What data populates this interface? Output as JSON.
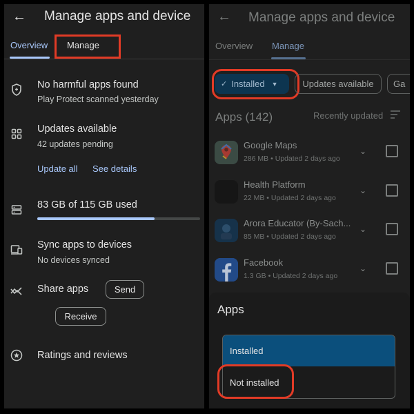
{
  "left": {
    "title": "Manage apps and device",
    "tabs": [
      {
        "label": "Overview",
        "active": true
      },
      {
        "label": "Manage",
        "active": false
      }
    ],
    "protect": {
      "title": "No harmful apps found",
      "subtitle": "Play Protect scanned yesterday",
      "icon": "shield-icon"
    },
    "updates": {
      "title": "Updates available",
      "subtitle": "42 updates pending",
      "icon": "apps-grid-icon",
      "update_all": "Update all",
      "see_details": "See details"
    },
    "storage": {
      "title": "83 GB of 115 GB used",
      "used_gb": 83,
      "total_gb": 115,
      "icon": "storage-icon"
    },
    "sync": {
      "title": "Sync apps to devices",
      "subtitle": "No devices synced",
      "icon": "devices-icon"
    },
    "share": {
      "title": "Share apps",
      "send": "Send",
      "receive": "Receive",
      "icon": "share-arrows-icon"
    },
    "ratings": {
      "title": "Ratings and reviews",
      "icon": "star-circle-icon"
    }
  },
  "right": {
    "title": "Manage apps and device",
    "tabs": [
      {
        "label": "Overview",
        "active": false
      },
      {
        "label": "Manage",
        "active": true
      }
    ],
    "chips": [
      {
        "label": "Installed",
        "selected": true
      },
      {
        "label": "Updates available",
        "selected": false
      },
      {
        "label": "Ga",
        "selected": false
      }
    ],
    "apps_header": "Apps (142)",
    "sort_label": "Recently updated",
    "apps": [
      {
        "name": "Google Maps",
        "meta": "286 MB • Updated 2 days ago",
        "icon": "google-maps-icon"
      },
      {
        "name": "Health Platform",
        "meta": "22 MB • Updated 2 days ago",
        "icon": "health-platform-icon"
      },
      {
        "name": "Arora Educator (By-Sach...",
        "meta": "85 MB • Updated 2 days ago",
        "icon": "arora-educator-icon"
      },
      {
        "name": "Facebook",
        "meta": "1.3 GB • Updated 2 days ago",
        "icon": "facebook-icon"
      }
    ],
    "sheet": {
      "title": "Apps",
      "options": [
        {
          "label": "Installed",
          "selected": true
        },
        {
          "label": "Not installed",
          "selected": false
        }
      ]
    }
  },
  "colors": {
    "accent": "#a8c7fa",
    "highlight": "#e23b26",
    "selected_option": "#0b4f7c",
    "panel": "#1f1f1f"
  }
}
